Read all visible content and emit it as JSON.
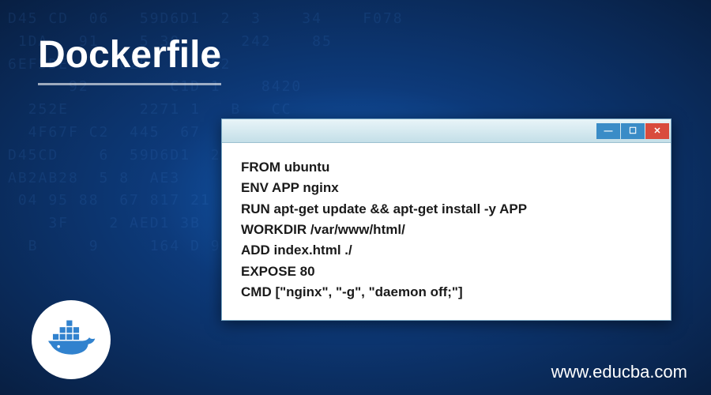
{
  "title": "Dockerfile",
  "window": {
    "minimize_symbol": "—",
    "maximize_symbol": "☐",
    "close_symbol": "✕"
  },
  "code": {
    "lines": [
      "FROM ubuntu",
      "ENV APP nginx",
      "RUN apt-get update && apt-get install -y APP",
      "WORKDIR /var/www/html/",
      "ADD index.html ./",
      "EXPOSE 80",
      "CMD [\"nginx\", \"-g\", \"daemon off;\"]"
    ]
  },
  "website": "www.educba.com",
  "bg_chars": "D45 CD  06   59D6D1  2  3    34    F078\n 1DA   91    5 30      242    85\n6EF5DE     62D      E2\n      92        C1D 1    8420\n  252E       2271 1   B   CC\n  4F67F C2  445  67   B5  4\nD45CD    6  59D6D1  2  3   34  F078\nAB2AB28  5 8  AE3        0  2 9\n 04 95 88  67 817 21   F5 04\n    3F    2 AED1 3B    03 729AE\n  B     9     164 D 93   OE"
}
